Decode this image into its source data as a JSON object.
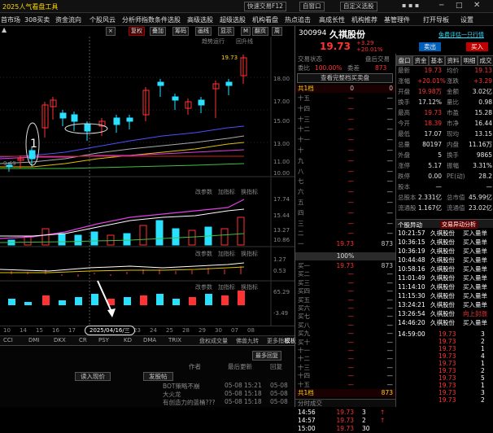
{
  "titlebar": {
    "app_title": "2025人气看盘工具",
    "quick_trade": "快速交易F12",
    "self_window": "自窗口",
    "self_select": "自定义选股",
    "icon_dots": "▪ ▪ ▪"
  },
  "menu": [
    "首市场",
    "308买卖",
    "资金流向",
    "个股风云",
    "分析师指数",
    "条件选股",
    "高级选股",
    "超级选股",
    "机构看盘",
    "热点追击",
    "高成长性",
    "机构推荐",
    "基管理件",
    "打开导板",
    "设置"
  ],
  "toolbar": {
    "time_items": [
      "×",
      "全景",
      "叠加",
      "筹码",
      "画线",
      "显示",
      "M",
      "翻页",
      "加仓",
      "周"
    ],
    "left": "▲",
    "badge": "复权"
  },
  "chart": {
    "price_labels": [
      "19.70",
      "18.00",
      "17.00",
      "16.00",
      "15.00",
      "14.00",
      "13.00",
      "12.00",
      "11.00",
      "10.00"
    ],
    "high_marker": "19.73",
    "low_marker": "9.49",
    "marker_one": "1",
    "series_labels": [
      "趋势运行",
      "回升线"
    ],
    "vol_labels": [
      "17.74",
      "15.44",
      "13.27",
      "10.86"
    ],
    "vol_bar_labels": [
      "改参数",
      "加指标",
      "换指标"
    ],
    "macd_labels": [
      "1.27",
      "0.53",
      "-0.16"
    ],
    "kdj_labels": [
      "65.29",
      "15.35",
      "-3.49"
    ]
  },
  "dates": [
    "10",
    "14",
    "15",
    "16",
    "17",
    "18",
    "21",
    "22",
    "23",
    "24",
    "25",
    "28",
    "29",
    "30",
    "07",
    "08"
  ],
  "highlight_date": "2025/04/16/三",
  "ind_tabs": [
    "CCI",
    "DMI",
    "DKX",
    "CR",
    "PSY",
    "KD",
    "DMA",
    "TRIX",
    "盘权成交量",
    "佛兽九转",
    "更多指标",
    "模板"
  ],
  "bottom": {
    "buttons": [
      "读入现价",
      "发股帖"
    ],
    "cols": [
      "作者",
      "最后更新",
      "回复"
    ],
    "rows": [
      [
        "BOT策略不崩",
        "05-08",
        "15:21",
        "05-08"
      ],
      [
        "大火龙",
        "05-08",
        "15:18",
        "05-08"
      ],
      [
        "有创造力的蓝桶???",
        "05-08",
        "15:18",
        "05-08"
      ]
    ],
    "sort_btn": "最多回复"
  },
  "quote": {
    "code": "300994",
    "name": "久祺股份",
    "price": "19.73",
    "change": "+3.29",
    "pct": "+20.01%",
    "action1": "免费评估一只行情",
    "action2": "卖出",
    "action3": "买入"
  },
  "book_header": {
    "a": "交易状态",
    "b": "盘后交易",
    "c": "委比",
    "d": "100.00%",
    "e": "委差",
    "f": "873",
    "g": "查看完整档买卖盘",
    "h": "共1档",
    "i": "0",
    "j": "0"
  },
  "sell_levels": [
    "十五",
    "十四",
    "十三",
    "十二",
    "十一",
    "十",
    "九",
    "八",
    "七",
    "六",
    "五",
    "四",
    "三",
    "二",
    "一"
  ],
  "sell_one": {
    "price": "19.73",
    "vol": "873"
  },
  "buy_levels": [
    "买一",
    "买二",
    "买三",
    "买四",
    "买五",
    "买六",
    "买七",
    "买八",
    "买九",
    "买十",
    "十一",
    "十二",
    "十三",
    "十四",
    "十五"
  ],
  "buy_one": {
    "price": "19.73",
    "vol": "873"
  },
  "book_footer": {
    "label": "共1档",
    "vol": "873",
    "minute_tab": "分时成交",
    "hundred": "100%",
    "ticks": [
      [
        "14:56",
        "19.73",
        "3",
        "↑"
      ],
      [
        "14:57",
        "19.73",
        "2",
        "↑"
      ],
      [
        "15:00",
        "19.73",
        "30",
        ""
      ]
    ]
  },
  "stat_tabs": [
    "盘口",
    "资金",
    "基本",
    "资料",
    "明细",
    "成交"
  ],
  "stats": [
    [
      "最新",
      "19.73",
      "均价",
      "19.13"
    ],
    [
      "涨幅",
      "+20.01%",
      "涨跌",
      "+3.29"
    ],
    [
      "开盘",
      "19.98万",
      "金额",
      "3.02亿"
    ],
    [
      "换手",
      "17.12%",
      "量比",
      "0.98"
    ],
    [
      "最高",
      "19.73",
      "市盈",
      "15.28"
    ],
    [
      "今开",
      "18.39",
      "市净",
      "16.44"
    ],
    [
      "最低",
      "17.07",
      "现均",
      "13.15"
    ],
    [
      "总量",
      "80197",
      "内盘",
      "11.16万"
    ],
    [
      "外盘",
      "5",
      "换手",
      "9865"
    ],
    [
      "涨停",
      "5.17",
      "振幅",
      "3.31%"
    ],
    [
      "跌停",
      "0.00",
      "PE(动)",
      "28.2"
    ],
    [
      "股本",
      "—",
      "",
      "—"
    ],
    [
      "总股本",
      "2.331亿",
      "总市值",
      "45.99亿"
    ],
    [
      "流通股",
      "1.167亿",
      "流通值",
      "23.02亿"
    ]
  ],
  "trade_header": {
    "title": "个股异动",
    "right": "交易异动分析"
  },
  "trades": [
    [
      "10:21:57",
      "久祺股份",
      "买入量单"
    ],
    [
      "10:36:15",
      "久祺股份",
      "买入量单"
    ],
    [
      "10:36:19",
      "久祺股份",
      "买入量单"
    ],
    [
      "10:44:48",
      "久祺股份",
      "买入量单"
    ],
    [
      "10:58:16",
      "久祺股份",
      "买入量单"
    ],
    [
      "11:01:49",
      "久祺股份",
      "买入量单"
    ],
    [
      "11:14:10",
      "久祺股份",
      "买入量单"
    ],
    [
      "11:15:30",
      "久祺股份",
      "买入量单"
    ],
    [
      "13:24:21",
      "久祺股份",
      "买入量单"
    ],
    [
      "13:26:54",
      "久祺股份",
      "向上封涨"
    ],
    [
      "14:46:20",
      "久祺股份",
      "买入量单"
    ]
  ],
  "tape": [
    [
      "14:59:00",
      "19.73",
      "3"
    ],
    [
      "",
      "19.73",
      "2"
    ],
    [
      "",
      "19.73",
      "1"
    ],
    [
      "",
      "19.73",
      "4"
    ],
    [
      "",
      "19.73",
      "1"
    ],
    [
      "",
      "19.73",
      "2"
    ],
    [
      "",
      "19.73",
      "5"
    ],
    [
      "",
      "19.73",
      "1"
    ],
    [
      "",
      "19.73",
      "3"
    ],
    [
      "",
      "19.73",
      "2"
    ],
    [
      "",
      "19.73",
      "1"
    ],
    [
      "",
      "19.73",
      "6"
    ],
    [
      "",
      "19.73",
      "1"
    ],
    [
      "",
      "19.73",
      "2"
    ],
    [
      "",
      "19.73",
      "1"
    ]
  ]
}
